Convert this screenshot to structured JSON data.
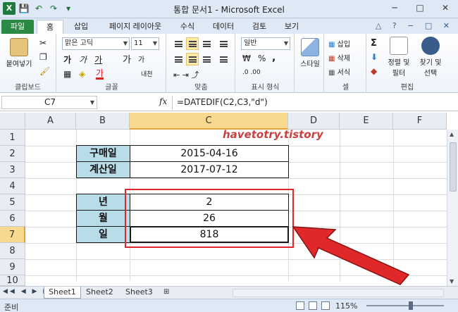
{
  "window": {
    "title": "통합 문서1 - Microsoft Excel",
    "minimize": "─",
    "restore": "□",
    "close": "✕"
  },
  "qat": {
    "excel_icon": "X",
    "save_icon": "💾",
    "undo_icon": "↶",
    "redo_icon": "↷",
    "customize_icon": "▾"
  },
  "tabs": [
    {
      "label": "파일"
    },
    {
      "label": "홈"
    },
    {
      "label": "삽입"
    },
    {
      "label": "페이지 레이아웃"
    },
    {
      "label": "수식"
    },
    {
      "label": "데이터"
    },
    {
      "label": "검토"
    },
    {
      "label": "보기"
    }
  ],
  "ribbon": {
    "clipboard": {
      "label": "클립보드",
      "paste": "붙여넣기"
    },
    "font": {
      "label": "글꼴",
      "font_name": "맑은 고딕",
      "font_size": "11",
      "bold": "가",
      "italic": "가",
      "underline": "가",
      "grow": "가",
      "shrink": "가",
      "phonetic": "내천"
    },
    "alignment": {
      "label": "맞춤"
    },
    "number": {
      "label": "표시 형식",
      "format": "일반",
      "currency": "₩",
      "percent": "%",
      "comma": ","
    },
    "styles": {
      "label": "",
      "style": "스타일"
    },
    "cells": {
      "label": "셀",
      "insert": "삽입",
      "delete": "삭제",
      "format": "서식"
    },
    "editing": {
      "label": "편집",
      "sort_filter": "정렬 및 필터",
      "find_select": "찾기 및 선택",
      "sigma": "Σ"
    }
  },
  "formula_bar": {
    "name_box": "C7",
    "fx": "fx",
    "formula": "=DATEDIF(C2,C3,\"d\")"
  },
  "columns": [
    "A",
    "B",
    "C",
    "D",
    "E",
    "F"
  ],
  "rows": [
    "1",
    "2",
    "3",
    "4",
    "5",
    "6",
    "7",
    "8",
    "9",
    "10"
  ],
  "cells": {
    "B2": "구매일",
    "C2": "2015-04-16",
    "B3": "계산일",
    "C3": "2017-07-12",
    "B5": "년",
    "C5": "2",
    "B6": "월",
    "C6": "26",
    "B7": "일",
    "C7": "818"
  },
  "watermark": "havetotry.tistory",
  "sheets": [
    {
      "name": "Sheet1",
      "active": true
    },
    {
      "name": "Sheet2",
      "active": false
    },
    {
      "name": "Sheet3",
      "active": false
    }
  ],
  "status": {
    "ready": "준비",
    "zoom": "115%"
  },
  "colors": {
    "accent_green": "#2a8a44",
    "header_fill": "#b8dce8",
    "annotation_red": "#e0282b",
    "selection": "#f9d98d"
  }
}
